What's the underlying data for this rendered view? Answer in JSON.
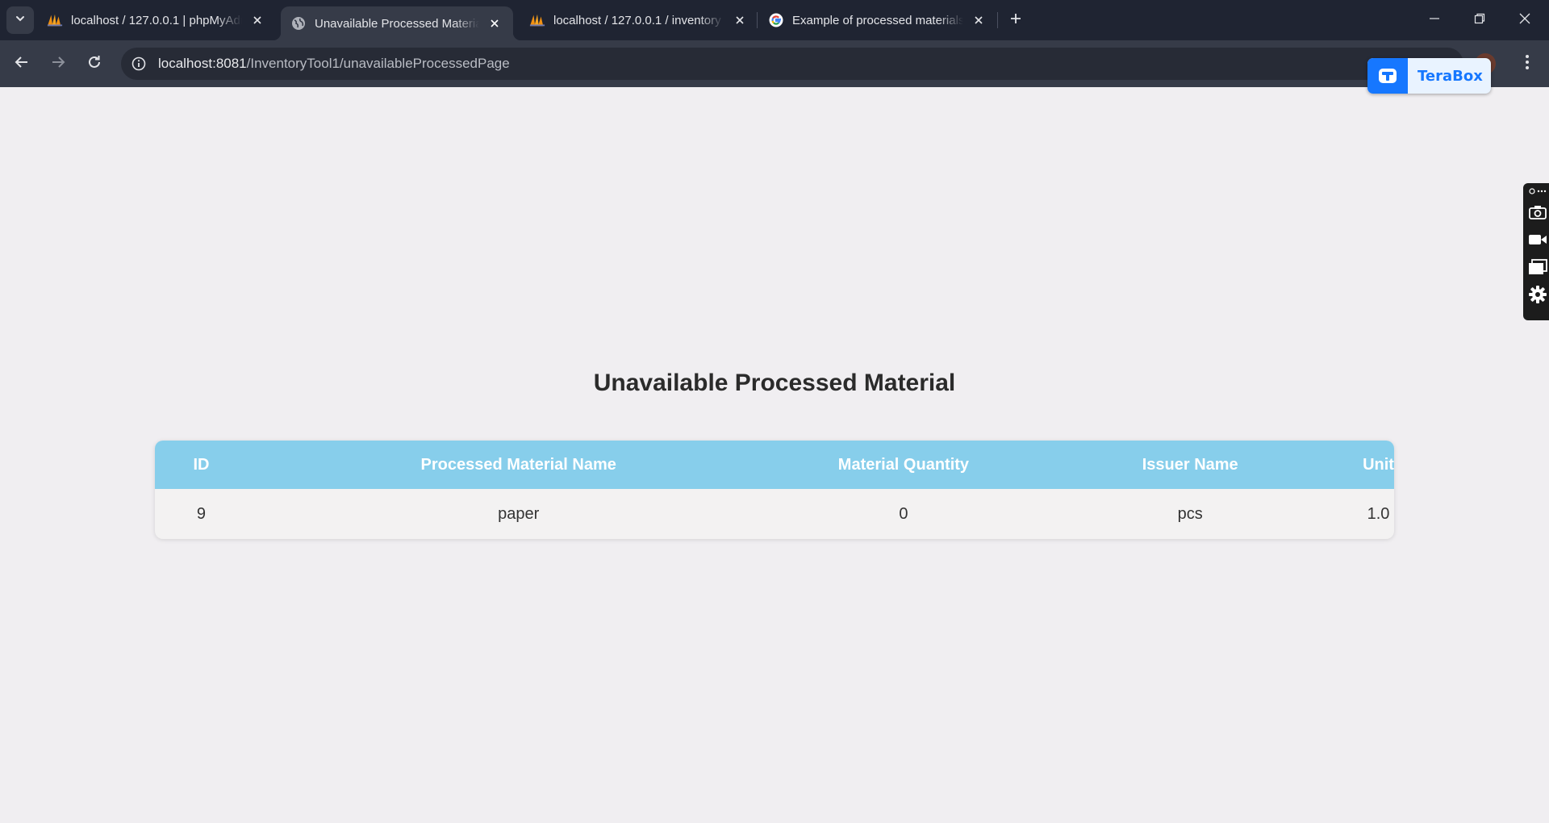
{
  "browser": {
    "tabs": [
      {
        "title": "localhost / 127.0.0.1 | phpMyAdmin",
        "favicon": "phpmyadmin-icon",
        "active": false
      },
      {
        "title": "Unavailable Processed Material",
        "favicon": "globe-icon",
        "active": true
      },
      {
        "title": "localhost / 127.0.0.1 / inventory",
        "favicon": "phpmyadmin-icon",
        "active": false
      },
      {
        "title": "Example of processed materials",
        "favicon": "google-icon",
        "active": false
      }
    ],
    "url_host": "localhost:8081",
    "url_path": "/InventoryTool1/unavailableProcessedPage"
  },
  "extensions": {
    "terabox_label": "TeraBox"
  },
  "page": {
    "title": "Unavailable Processed Material",
    "table": {
      "headers": [
        "ID",
        "Processed Material Name",
        "Material Quantity",
        "Issuer Name",
        "Unit"
      ],
      "rows": [
        [
          "9",
          "paper",
          "0",
          "pcs",
          "1.0"
        ]
      ]
    }
  },
  "colors": {
    "table_header_bg": "#87ceeb",
    "page_bg": "#f0eef1",
    "browser_dark": "#1f2432"
  }
}
